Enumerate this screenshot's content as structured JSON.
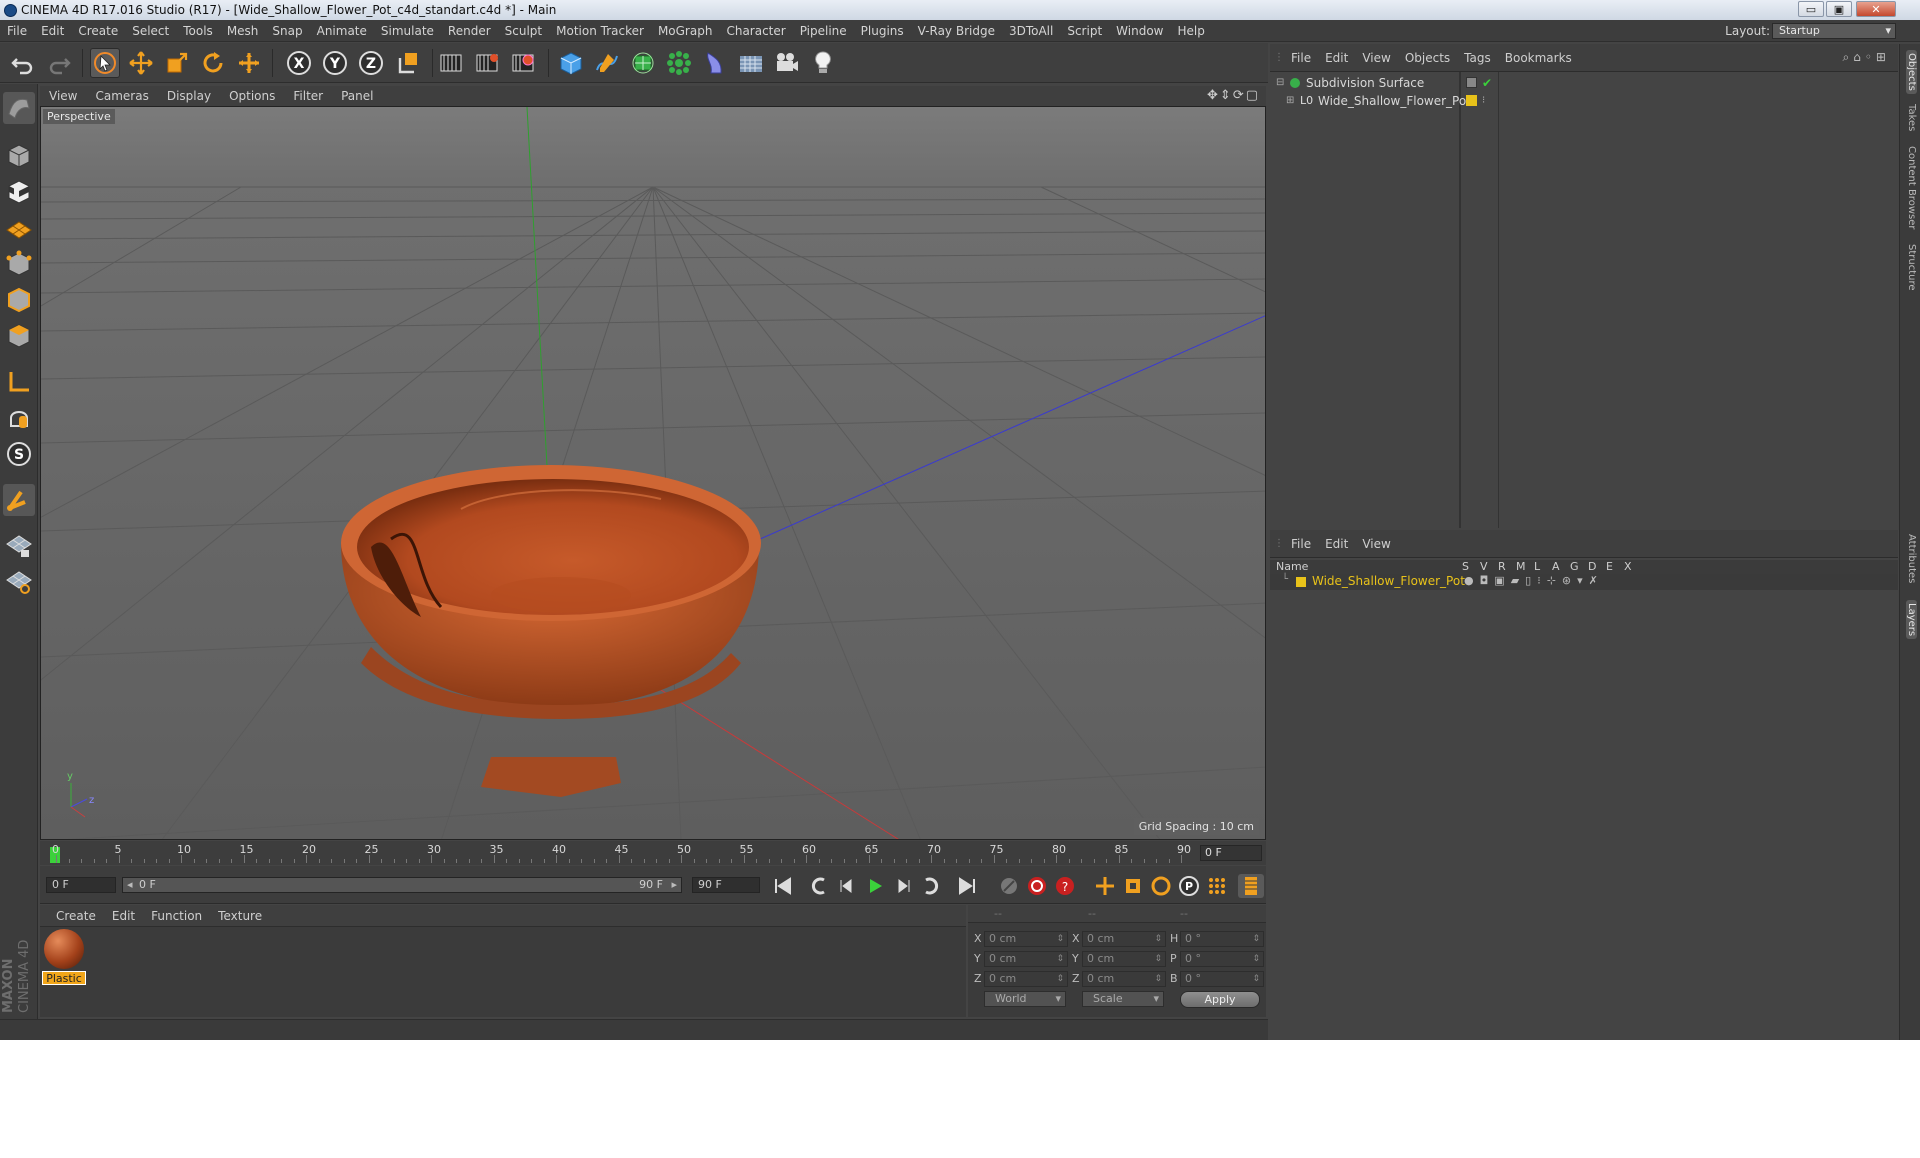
{
  "window": {
    "title": "CINEMA 4D R17.016 Studio (R17) - [Wide_Shallow_Flower_Pot_c4d_standart.c4d *] - Main",
    "minimize": "▭",
    "maximize": "▣",
    "close": "✕"
  },
  "menubar": {
    "items": [
      "File",
      "Edit",
      "Create",
      "Select",
      "Tools",
      "Mesh",
      "Snap",
      "Animate",
      "Simulate",
      "Render",
      "Sculpt",
      "Motion Tracker",
      "MoGraph",
      "Character",
      "Pipeline",
      "Plugins",
      "V-Ray Bridge",
      "3DToAll",
      "Script",
      "Window",
      "Help"
    ],
    "layout_label": "Layout:",
    "layout_value": "Startup"
  },
  "toolbar": {
    "icons": [
      "undo-icon",
      "redo-icon",
      "select-arrow-icon",
      "move-icon",
      "scale-icon",
      "rotate-icon",
      "live-select-icon",
      "x-axis-icon",
      "y-axis-icon",
      "z-axis-icon",
      "coordinate-system-icon",
      "render-view-icon",
      "render-region-icon",
      "render-settings-icon",
      "cube-icon",
      "pen-spline-icon",
      "subdivision-icon",
      "array-icon",
      "deformer-icon",
      "floor-icon",
      "camera-icon",
      "light-icon"
    ],
    "axis_x": "X",
    "axis_y": "Y",
    "axis_z": "Z"
  },
  "lefttools": {
    "icons": [
      "make-editable-icon",
      "model-mode-icon",
      "texture-mode-icon",
      "workplane-icon",
      "points-mode-icon",
      "edges-mode-icon",
      "polygons-mode-icon",
      "axis-mode-icon",
      "tweak-mode-icon",
      "snap-icon",
      "magnet-icon",
      "lock-workplane-icon",
      "workplane-grid-icon"
    ]
  },
  "branding": {
    "maxon": "MAXON",
    "product": "CINEMA 4D"
  },
  "viewport": {
    "menu": [
      "View",
      "Cameras",
      "Display",
      "Options",
      "Filter",
      "Panel"
    ],
    "label": "Perspective",
    "grid_spacing": "Grid Spacing : 10 cm",
    "axis_y": "y",
    "axis_z": "z",
    "object_color": "#c15a2c"
  },
  "timeline": {
    "ticks": [
      "0",
      "5",
      "10",
      "15",
      "20",
      "25",
      "30",
      "35",
      "40",
      "45",
      "50",
      "55",
      "60",
      "65",
      "70",
      "75",
      "80",
      "85",
      "90"
    ],
    "current_frame": "0 F"
  },
  "playback": {
    "start": "0 F",
    "range_start": "0 F",
    "range_end": "90 F",
    "end": "90 F"
  },
  "materials": {
    "menu": [
      "Create",
      "Edit",
      "Function",
      "Texture"
    ],
    "items": [
      {
        "name": "Plastic"
      }
    ]
  },
  "coordinates": {
    "head": [
      "--",
      "--",
      "--"
    ],
    "rows": [
      {
        "a": "X",
        "av": "0 cm",
        "b": "X",
        "bv": "0 cm",
        "c": "H",
        "cv": "0 °"
      },
      {
        "a": "Y",
        "av": "0 cm",
        "b": "Y",
        "bv": "0 cm",
        "c": "P",
        "cv": "0 °"
      },
      {
        "a": "Z",
        "av": "0 cm",
        "b": "Z",
        "bv": "0 cm",
        "c": "B",
        "cv": "0 °"
      }
    ],
    "space": "World",
    "mode": "Scale",
    "apply": "Apply"
  },
  "objects": {
    "menu": [
      "File",
      "Edit",
      "View",
      "Objects",
      "Tags",
      "Bookmarks"
    ],
    "items": [
      {
        "name": "Subdivision Surface"
      },
      {
        "name": "Wide_Shallow_Flower_Pot"
      }
    ]
  },
  "layers": {
    "menu": [
      "File",
      "Edit",
      "View"
    ],
    "columns": [
      "Name",
      "S",
      "V",
      "R",
      "M",
      "L",
      "A",
      "G",
      "D",
      "E",
      "X"
    ],
    "items": [
      {
        "name": "Wide_Shallow_Flower_Pot",
        "color": "#e8c21a"
      }
    ]
  },
  "rightstrip": {
    "tabs": [
      "Objects",
      "Takes",
      "Content Browser",
      "Structure",
      "Attributes",
      "Layers"
    ]
  }
}
